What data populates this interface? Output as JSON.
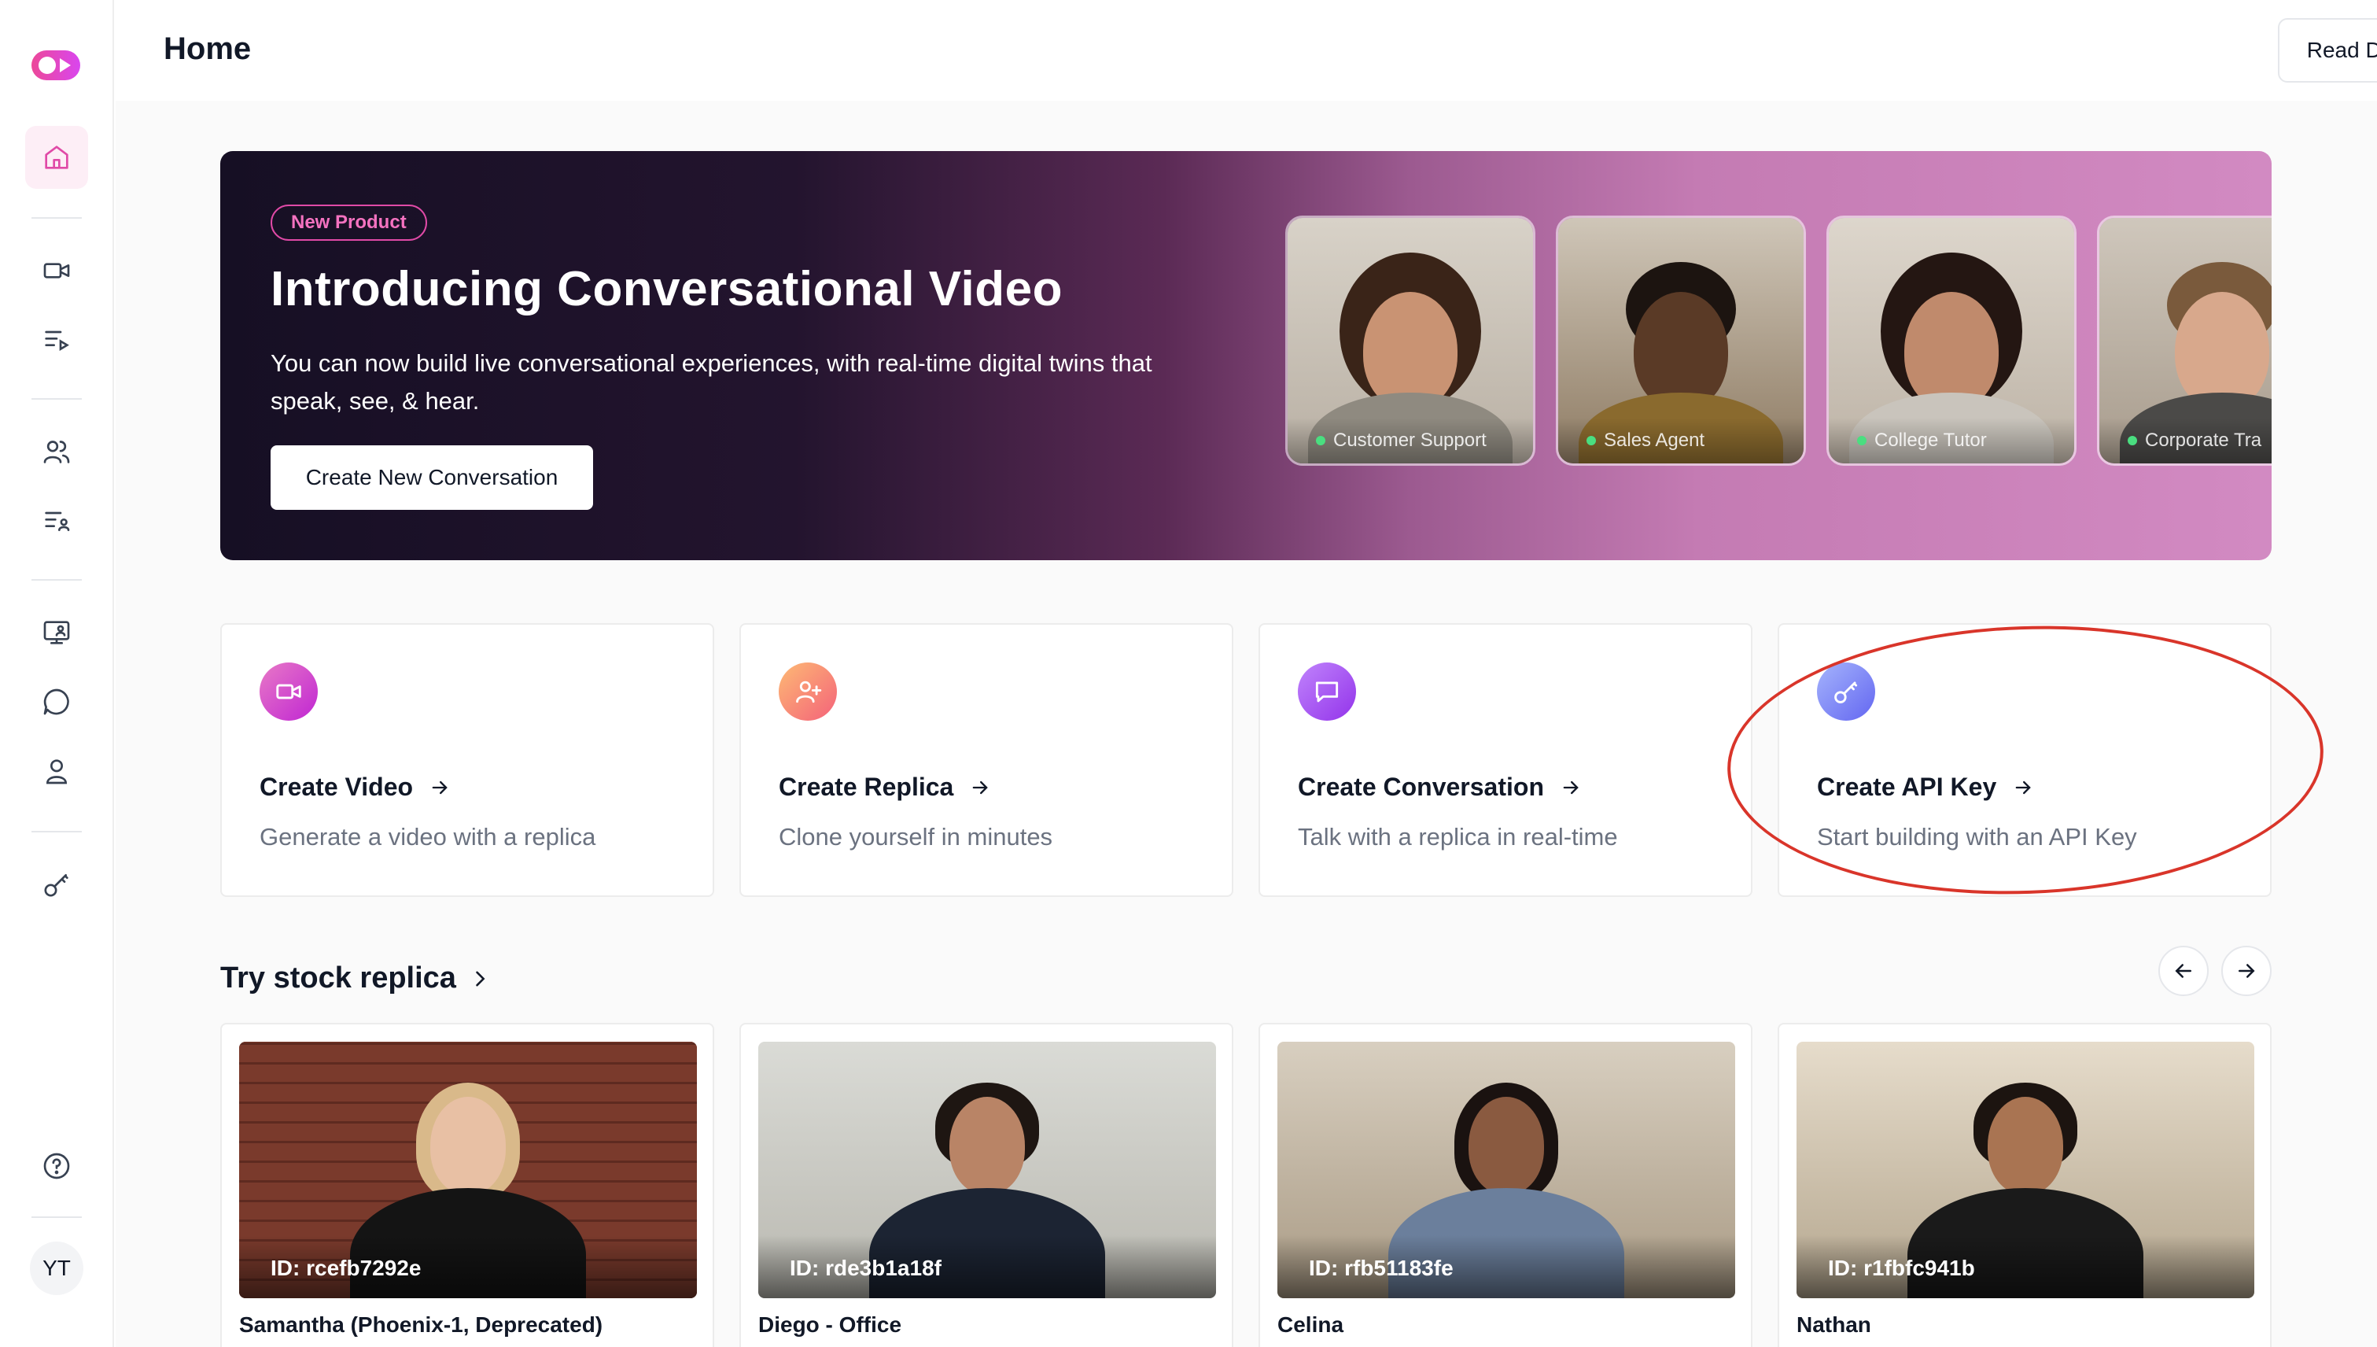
{
  "header": {
    "title": "Home",
    "read_docs_label": "Read Docs"
  },
  "sidebar": {
    "avatar_initials": "YT",
    "items": [
      {
        "name": "home",
        "icon": "home-icon",
        "active": true
      },
      {
        "name": "videos",
        "icon": "video-camera-icon"
      },
      {
        "name": "video-list",
        "icon": "play-list-icon"
      },
      {
        "name": "replicas",
        "icon": "users-icon"
      },
      {
        "name": "replica-list",
        "icon": "user-list-icon"
      },
      {
        "name": "conversations",
        "icon": "monitor-icon"
      },
      {
        "name": "chat",
        "icon": "chat-bubble-icon"
      },
      {
        "name": "personas",
        "icon": "user-icon"
      },
      {
        "name": "api-keys",
        "icon": "key-icon"
      },
      {
        "name": "help",
        "icon": "help-circle-icon"
      }
    ]
  },
  "banner": {
    "badge": "New Product",
    "title": "Introducing Conversational Video",
    "description": "You can now build live conversational experiences, with real-time digital twins that speak, see, & hear.",
    "cta": "Create New Conversation",
    "personas": [
      {
        "label": "Customer Support"
      },
      {
        "label": "Sales Agent"
      },
      {
        "label": "College Tutor"
      },
      {
        "label": "Corporate Tra"
      }
    ]
  },
  "cards": [
    {
      "title": "Create Video",
      "subtitle": "Generate a video with a replica",
      "icon": "video-camera-icon",
      "color": "#d946a8"
    },
    {
      "title": "Create Replica",
      "subtitle": "Clone yourself in minutes",
      "icon": "user-plus-icon",
      "color": "#f97360"
    },
    {
      "title": "Create Conversation",
      "subtitle": "Talk with a replica in real-time",
      "icon": "chat-bubble-icon",
      "color": "#a855f7"
    },
    {
      "title": "Create API Key",
      "subtitle": "Start building with an API Key",
      "icon": "key-icon",
      "color": "#6366f1"
    }
  ],
  "stock": {
    "title": "Try stock replica",
    "replicas": [
      {
        "id": "ID: rcefb7292e",
        "name": "Samantha (Phoenix-1, Deprecated)"
      },
      {
        "id": "ID: rde3b1a18f",
        "name": "Diego - Office"
      },
      {
        "id": "ID: rfb51183fe",
        "name": "Celina"
      },
      {
        "id": "ID: r1fbfc941b",
        "name": "Nathan"
      }
    ]
  },
  "colors": {
    "accent": "#e04aa7",
    "annotation": "#d9352a"
  }
}
